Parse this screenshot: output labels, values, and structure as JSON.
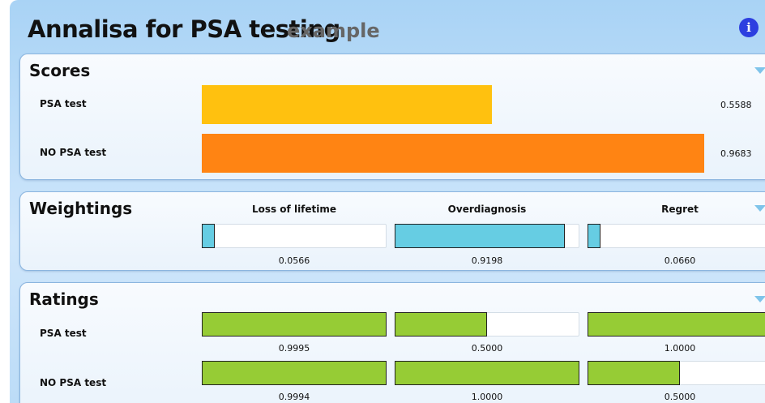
{
  "header": {
    "title": "Annalisa for PSA testing",
    "subtitle": "example",
    "info_icon": "info-icon"
  },
  "colors": {
    "psa_score": "#ffc10f",
    "no_psa_score": "#ff8413",
    "weighting": "#66cde3",
    "rating": "#96cc35"
  },
  "scores": {
    "title": "Scores",
    "rows": [
      {
        "label": "PSA test",
        "value": "0.5588",
        "fraction": 0.5588
      },
      {
        "label": "NO PSA test",
        "value": "0.9683",
        "fraction": 0.9683
      }
    ]
  },
  "weightings": {
    "title": "Weightings",
    "columns": [
      {
        "label": "Loss of lifetime",
        "value": "0.0566",
        "fraction": 0.0566
      },
      {
        "label": "Overdiagnosis",
        "value": "0.9198",
        "fraction": 0.9198
      },
      {
        "label": "Regret",
        "value": "0.0660",
        "fraction": 0.066
      }
    ]
  },
  "ratings": {
    "title": "Ratings",
    "rows": [
      {
        "label": "PSA test",
        "cells": [
          {
            "value": "0.9995",
            "fraction": 0.9995
          },
          {
            "value": "0.5000",
            "fraction": 0.5
          },
          {
            "value": "1.0000",
            "fraction": 1.0
          }
        ]
      },
      {
        "label": "NO PSA test",
        "cells": [
          {
            "value": "0.9994",
            "fraction": 0.9994
          },
          {
            "value": "1.0000",
            "fraction": 1.0
          },
          {
            "value": "0.5000",
            "fraction": 0.5
          }
        ]
      }
    ]
  }
}
